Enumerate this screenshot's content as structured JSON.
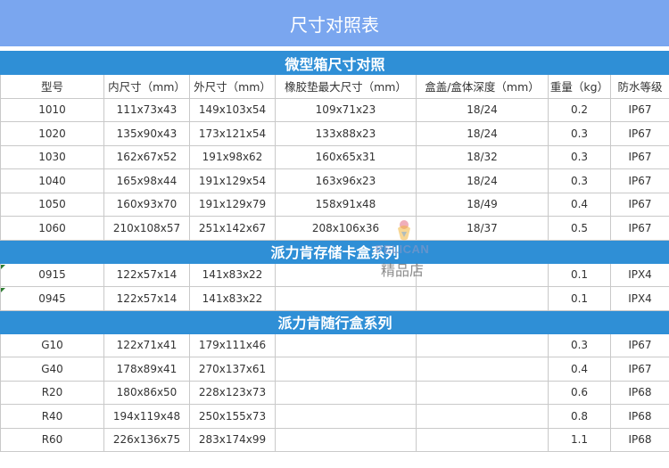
{
  "title": "尺寸对照表",
  "sections": [
    {
      "name": "微型箱尺寸对照"
    },
    {
      "name": "派力肯存储卡盒系列"
    },
    {
      "name": "派力肯随行盒系列"
    }
  ],
  "columns": [
    "型号",
    "内尺寸（mm）",
    "外尺寸（mm）",
    "橡胶垫最大尺寸（mm）",
    "盒盖/盒体深度（mm）",
    "重量（kg）",
    "防水等级"
  ],
  "micro_rows": [
    [
      "1010",
      "111x73x43",
      "149x103x54",
      "109x71x23",
      "18/24",
      "0.2",
      "IP67"
    ],
    [
      "1020",
      "135x90x43",
      "173x121x54",
      "133x88x23",
      "18/24",
      "0.3",
      "IP67"
    ],
    [
      "1030",
      "162x67x52",
      "191x98x62",
      "160x65x31",
      "18/32",
      "0.3",
      "IP67"
    ],
    [
      "1040",
      "165x98x44",
      "191x129x54",
      "163x96x23",
      "18/24",
      "0.3",
      "IP67"
    ],
    [
      "1050",
      "160x93x70",
      "191x129x79",
      "158x91x48",
      "18/49",
      "0.4",
      "IP67"
    ],
    [
      "1060",
      "210x108x57",
      "251x142x67",
      "208x106x36",
      "18/37",
      "0.5",
      "IP67"
    ]
  ],
  "card_rows": [
    [
      "0915",
      "122x57x14",
      "141x83x22",
      "",
      "",
      "0.1",
      "IPX4"
    ],
    [
      "0945",
      "122x57x14",
      "141x83x22",
      "",
      "",
      "0.1",
      "IPX4"
    ]
  ],
  "travel_rows": [
    [
      "G10",
      "122x71x41",
      "179x111x46",
      "",
      "",
      "0.3",
      "IP67"
    ],
    [
      "G40",
      "178x89x41",
      "270x137x61",
      "",
      "",
      "0.4",
      "IP67"
    ],
    [
      "R20",
      "180x86x50",
      "228x123x73",
      "",
      "",
      "0.6",
      "IP68"
    ],
    [
      "R40",
      "194x119x48",
      "250x155x73",
      "",
      "",
      "0.8",
      "IP68"
    ],
    [
      "R60",
      "226x136x75",
      "283x174x99",
      "",
      "",
      "1.1",
      "IP68"
    ]
  ],
  "watermark": {
    "brand": "PELICAN",
    "store": "精品店",
    "logo_icon": "pelican-bird-icon"
  },
  "colors": {
    "title_bar": "#7aa6ef",
    "section_bar": "#2f8fd6",
    "border": "#c9c9c9"
  }
}
